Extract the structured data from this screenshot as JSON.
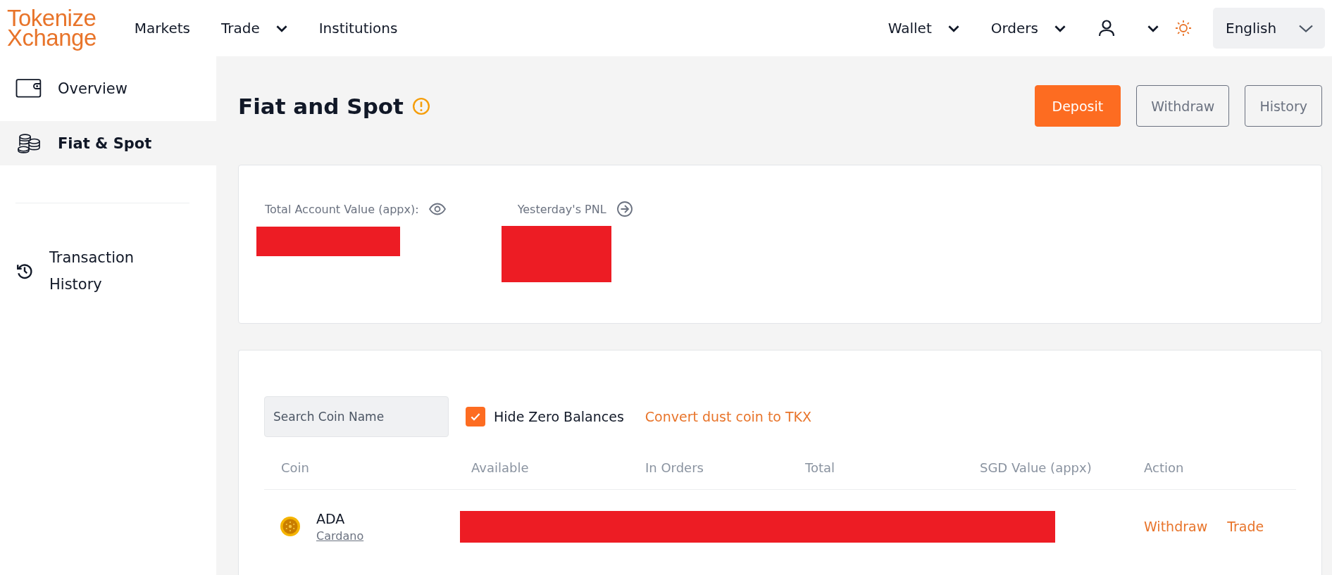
{
  "logo": {
    "line_1": "Tokenize",
    "line_2": "Xchange"
  },
  "nav": {
    "left": [
      {
        "label": "Markets",
        "dropdown": false
      },
      {
        "label": "Trade",
        "dropdown": true
      },
      {
        "label": "Institutions",
        "dropdown": false
      }
    ],
    "right": [
      {
        "label": "Wallet",
        "dropdown": true
      },
      {
        "label": "Orders",
        "dropdown": true
      }
    ],
    "language": "English"
  },
  "sidebar": {
    "groups": [
      [
        {
          "label": "Overview",
          "kind": "wallet",
          "selected": false
        },
        {
          "label": "Fiat & Spot",
          "kind": "coins",
          "selected": true
        }
      ],
      [
        {
          "label": "Transaction History",
          "kind": "history",
          "selected": false
        }
      ]
    ]
  },
  "page": {
    "title": "Fiat and Spot",
    "buttons": [
      {
        "label": "Deposit",
        "primary": true
      },
      {
        "label": "Withdraw",
        "primary": false
      },
      {
        "label": "History",
        "primary": false
      }
    ]
  },
  "summary": {
    "items": [
      {
        "label": "Total Account Value (appx):",
        "kind": "eye"
      },
      {
        "label": "Yesterday's PNL",
        "kind": "arrow"
      }
    ]
  },
  "balances": {
    "search": {
      "placeholder": "Search Coin Name"
    },
    "hide_zero": {
      "label": "Hide Zero Balances",
      "checked": true
    },
    "convert_link": "Convert dust coin to TKX",
    "table": {
      "columns": [
        "Coin",
        "Available",
        "In Orders",
        "Total",
        "SGD Value (appx)",
        "Action"
      ],
      "rows": [
        {
          "symbol": "ADA",
          "name": "Cardano",
          "actions": [
            "Withdraw",
            "Trade"
          ]
        }
      ]
    }
  }
}
